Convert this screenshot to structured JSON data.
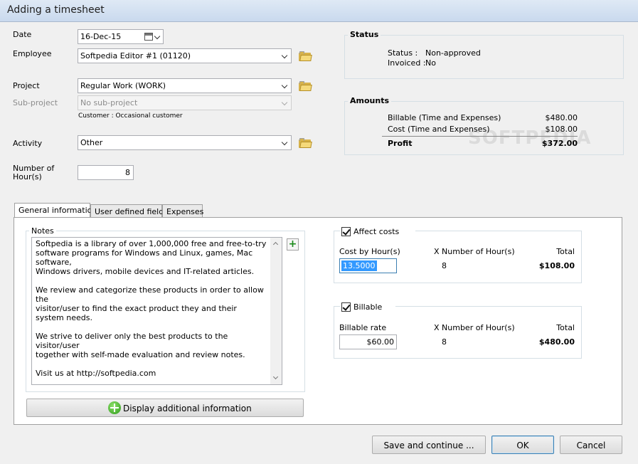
{
  "window": {
    "title": "Adding a timesheet"
  },
  "form": {
    "date_label": "Date",
    "date_value": "16-Dec-15",
    "employee_label": "Employee",
    "employee_value": "Softpedia Editor #1 (01120)",
    "project_label": "Project",
    "project_value": "Regular Work (WORK)",
    "subproject_label": "Sub-project",
    "subproject_value": "No sub-project",
    "customer_note": "Customer : Occasional customer",
    "activity_label": "Activity",
    "activity_value": "Other",
    "hours_label_line1": "Number of",
    "hours_label_line2": "Hour(s)",
    "hours_value": "8"
  },
  "status": {
    "title": "Status",
    "status_label": "Status :",
    "status_value": "Non-approved",
    "invoiced_label": "Invoiced :",
    "invoiced_value": "No"
  },
  "amounts": {
    "title": "Amounts",
    "rows": [
      {
        "label": "Billable (Time and Expenses)",
        "value": "$480.00"
      },
      {
        "label": "Cost (Time and Expenses)",
        "value": "$108.00"
      },
      {
        "label": "Profit",
        "value": "$372.00"
      }
    ]
  },
  "watermark": "SOFTPEDIA",
  "tabs": [
    {
      "label": "General information",
      "active": true
    },
    {
      "label": "User defined fields",
      "active": false
    },
    {
      "label": "Expenses",
      "active": false
    }
  ],
  "notes": {
    "title": "Notes",
    "text": "Softpedia is a library of over 1,000,000 free and free-to-try\nsoftware programs for Windows and Linux, games, Mac software,\nWindows drivers, mobile devices and IT-related articles.\n\nWe review and categorize these products in order to allow the\nvisitor/user to find the exact product they and their system needs.\n\nWe strive to deliver only the best products to the visitor/user\ntogether with self-made evaluation and review notes.\n\nVisit us at http://softpedia.com",
    "add_button": "+"
  },
  "display_more_button": "Display additional information",
  "costs": {
    "checkbox_label": "Affect costs",
    "checked": true,
    "rate_label": "Cost by Hour(s)",
    "hours_label": "X Number of  Hour(s)",
    "total_label": "Total",
    "rate_value": "13.5000",
    "hours_value": "8",
    "total_value": "$108.00"
  },
  "billable": {
    "checkbox_label": "Billable",
    "checked": true,
    "rate_label": "Billable rate",
    "hours_label": "X Number of  Hour(s)",
    "total_label": "Total",
    "rate_value": "$60.00",
    "hours_value": "8",
    "total_value": "$480.00"
  },
  "buttons": {
    "save_continue": "Save and continue ...",
    "ok": "OK",
    "cancel": "Cancel"
  }
}
